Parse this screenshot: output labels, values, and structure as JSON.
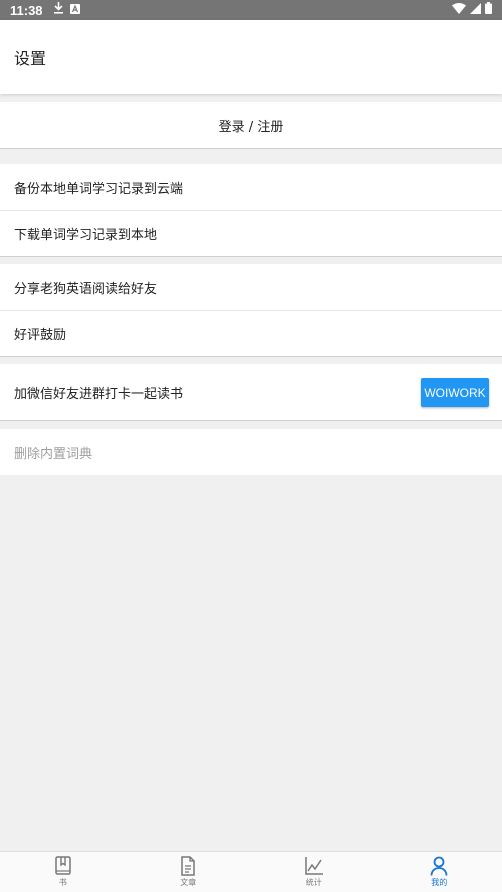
{
  "status_bar": {
    "time": "11:38",
    "icons": [
      "download-icon",
      "a-icon",
      "wifi-icon",
      "signal-icon",
      "battery-icon"
    ]
  },
  "app_bar": {
    "title": "设置"
  },
  "login": {
    "label": "登录 / 注册"
  },
  "sync_group": {
    "items": [
      {
        "label": "备份本地单词学习记录到云端"
      },
      {
        "label": "下载单词学习记录到本地"
      }
    ]
  },
  "share_group": {
    "items": [
      {
        "label": "分享老狗英语阅读给好友"
      },
      {
        "label": "好评鼓励"
      }
    ]
  },
  "wechat": {
    "label": "加微信好友进群打卡一起读书",
    "button_label": "WOIWORK"
  },
  "delete_dict": {
    "label": "删除内置词典"
  },
  "bottom_nav": {
    "items": [
      {
        "label": "书",
        "icon": "book-icon"
      },
      {
        "label": "文章",
        "icon": "document-icon"
      },
      {
        "label": "统计",
        "icon": "chart-icon"
      },
      {
        "label": "我的",
        "icon": "person-icon"
      }
    ],
    "active_index": 3
  },
  "colors": {
    "accent": "#2196f3",
    "active_nav": "#1976d2",
    "background": "#f0f0f0",
    "status_bar": "#757575"
  }
}
